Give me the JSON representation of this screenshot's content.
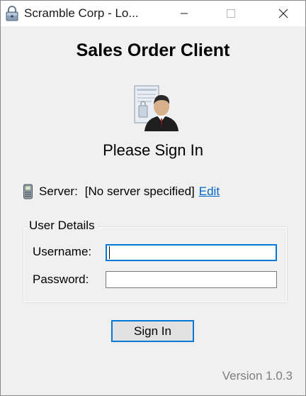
{
  "window": {
    "title": "Scramble Corp - Lo...",
    "controls": [
      "minimize",
      "maximize",
      "close"
    ]
  },
  "header": {
    "app_title": "Sales Order Client",
    "illustration_icon": "user-with-document-icon",
    "heading": "Please Sign In"
  },
  "server": {
    "icon": "phone-icon",
    "label": "Server:",
    "value": "[No server specified]",
    "edit_link": "Edit"
  },
  "user_details": {
    "legend": "User Details",
    "username_label": "Username:",
    "username_value": "",
    "password_label": "Password:",
    "password_value": ""
  },
  "actions": {
    "sign_in_label": "Sign In"
  },
  "footer": {
    "version": "Version 1.0.3"
  },
  "colors": {
    "accent": "#0078d7",
    "link": "#0066cc",
    "window_bg": "#f0f0f0",
    "muted_text": "#7d7d7d"
  }
}
